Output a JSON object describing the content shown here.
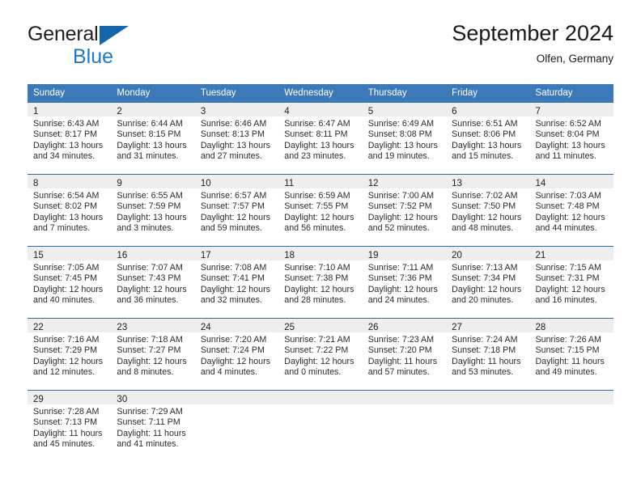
{
  "brand": {
    "name_part1": "General",
    "name_part2": "Blue",
    "logo_icon": "blue-triangle-icon",
    "color_dark": "#231f20",
    "color_blue": "#1f7ac4"
  },
  "header": {
    "title": "September 2024",
    "location": "Olfen, Germany"
  },
  "theme": {
    "header_bg": "#3b79b8",
    "header_text": "#ffffff",
    "row_divider": "#2a6ca8",
    "daynum_band": "#eeeeee",
    "body_text": "#2b2b2b"
  },
  "weekdays": [
    "Sunday",
    "Monday",
    "Tuesday",
    "Wednesday",
    "Thursday",
    "Friday",
    "Saturday"
  ],
  "weeks": [
    [
      {
        "day": "1",
        "lines": [
          "Sunrise: 6:43 AM",
          "Sunset: 8:17 PM",
          "Daylight: 13 hours",
          "and 34 minutes."
        ]
      },
      {
        "day": "2",
        "lines": [
          "Sunrise: 6:44 AM",
          "Sunset: 8:15 PM",
          "Daylight: 13 hours",
          "and 31 minutes."
        ]
      },
      {
        "day": "3",
        "lines": [
          "Sunrise: 6:46 AM",
          "Sunset: 8:13 PM",
          "Daylight: 13 hours",
          "and 27 minutes."
        ]
      },
      {
        "day": "4",
        "lines": [
          "Sunrise: 6:47 AM",
          "Sunset: 8:11 PM",
          "Daylight: 13 hours",
          "and 23 minutes."
        ]
      },
      {
        "day": "5",
        "lines": [
          "Sunrise: 6:49 AM",
          "Sunset: 8:08 PM",
          "Daylight: 13 hours",
          "and 19 minutes."
        ]
      },
      {
        "day": "6",
        "lines": [
          "Sunrise: 6:51 AM",
          "Sunset: 8:06 PM",
          "Daylight: 13 hours",
          "and 15 minutes."
        ]
      },
      {
        "day": "7",
        "lines": [
          "Sunrise: 6:52 AM",
          "Sunset: 8:04 PM",
          "Daylight: 13 hours",
          "and 11 minutes."
        ]
      }
    ],
    [
      {
        "day": "8",
        "lines": [
          "Sunrise: 6:54 AM",
          "Sunset: 8:02 PM",
          "Daylight: 13 hours",
          "and 7 minutes."
        ]
      },
      {
        "day": "9",
        "lines": [
          "Sunrise: 6:55 AM",
          "Sunset: 7:59 PM",
          "Daylight: 13 hours",
          "and 3 minutes."
        ]
      },
      {
        "day": "10",
        "lines": [
          "Sunrise: 6:57 AM",
          "Sunset: 7:57 PM",
          "Daylight: 12 hours",
          "and 59 minutes."
        ]
      },
      {
        "day": "11",
        "lines": [
          "Sunrise: 6:59 AM",
          "Sunset: 7:55 PM",
          "Daylight: 12 hours",
          "and 56 minutes."
        ]
      },
      {
        "day": "12",
        "lines": [
          "Sunrise: 7:00 AM",
          "Sunset: 7:52 PM",
          "Daylight: 12 hours",
          "and 52 minutes."
        ]
      },
      {
        "day": "13",
        "lines": [
          "Sunrise: 7:02 AM",
          "Sunset: 7:50 PM",
          "Daylight: 12 hours",
          "and 48 minutes."
        ]
      },
      {
        "day": "14",
        "lines": [
          "Sunrise: 7:03 AM",
          "Sunset: 7:48 PM",
          "Daylight: 12 hours",
          "and 44 minutes."
        ]
      }
    ],
    [
      {
        "day": "15",
        "lines": [
          "Sunrise: 7:05 AM",
          "Sunset: 7:45 PM",
          "Daylight: 12 hours",
          "and 40 minutes."
        ]
      },
      {
        "day": "16",
        "lines": [
          "Sunrise: 7:07 AM",
          "Sunset: 7:43 PM",
          "Daylight: 12 hours",
          "and 36 minutes."
        ]
      },
      {
        "day": "17",
        "lines": [
          "Sunrise: 7:08 AM",
          "Sunset: 7:41 PM",
          "Daylight: 12 hours",
          "and 32 minutes."
        ]
      },
      {
        "day": "18",
        "lines": [
          "Sunrise: 7:10 AM",
          "Sunset: 7:38 PM",
          "Daylight: 12 hours",
          "and 28 minutes."
        ]
      },
      {
        "day": "19",
        "lines": [
          "Sunrise: 7:11 AM",
          "Sunset: 7:36 PM",
          "Daylight: 12 hours",
          "and 24 minutes."
        ]
      },
      {
        "day": "20",
        "lines": [
          "Sunrise: 7:13 AM",
          "Sunset: 7:34 PM",
          "Daylight: 12 hours",
          "and 20 minutes."
        ]
      },
      {
        "day": "21",
        "lines": [
          "Sunrise: 7:15 AM",
          "Sunset: 7:31 PM",
          "Daylight: 12 hours",
          "and 16 minutes."
        ]
      }
    ],
    [
      {
        "day": "22",
        "lines": [
          "Sunrise: 7:16 AM",
          "Sunset: 7:29 PM",
          "Daylight: 12 hours",
          "and 12 minutes."
        ]
      },
      {
        "day": "23",
        "lines": [
          "Sunrise: 7:18 AM",
          "Sunset: 7:27 PM",
          "Daylight: 12 hours",
          "and 8 minutes."
        ]
      },
      {
        "day": "24",
        "lines": [
          "Sunrise: 7:20 AM",
          "Sunset: 7:24 PM",
          "Daylight: 12 hours",
          "and 4 minutes."
        ]
      },
      {
        "day": "25",
        "lines": [
          "Sunrise: 7:21 AM",
          "Sunset: 7:22 PM",
          "Daylight: 12 hours",
          "and 0 minutes."
        ]
      },
      {
        "day": "26",
        "lines": [
          "Sunrise: 7:23 AM",
          "Sunset: 7:20 PM",
          "Daylight: 11 hours",
          "and 57 minutes."
        ]
      },
      {
        "day": "27",
        "lines": [
          "Sunrise: 7:24 AM",
          "Sunset: 7:18 PM",
          "Daylight: 11 hours",
          "and 53 minutes."
        ]
      },
      {
        "day": "28",
        "lines": [
          "Sunrise: 7:26 AM",
          "Sunset: 7:15 PM",
          "Daylight: 11 hours",
          "and 49 minutes."
        ]
      }
    ],
    [
      {
        "day": "29",
        "lines": [
          "Sunrise: 7:28 AM",
          "Sunset: 7:13 PM",
          "Daylight: 11 hours",
          "and 45 minutes."
        ]
      },
      {
        "day": "30",
        "lines": [
          "Sunrise: 7:29 AM",
          "Sunset: 7:11 PM",
          "Daylight: 11 hours",
          "and 41 minutes."
        ]
      },
      {
        "day": "",
        "lines": []
      },
      {
        "day": "",
        "lines": []
      },
      {
        "day": "",
        "lines": []
      },
      {
        "day": "",
        "lines": []
      },
      {
        "day": "",
        "lines": []
      }
    ]
  ]
}
